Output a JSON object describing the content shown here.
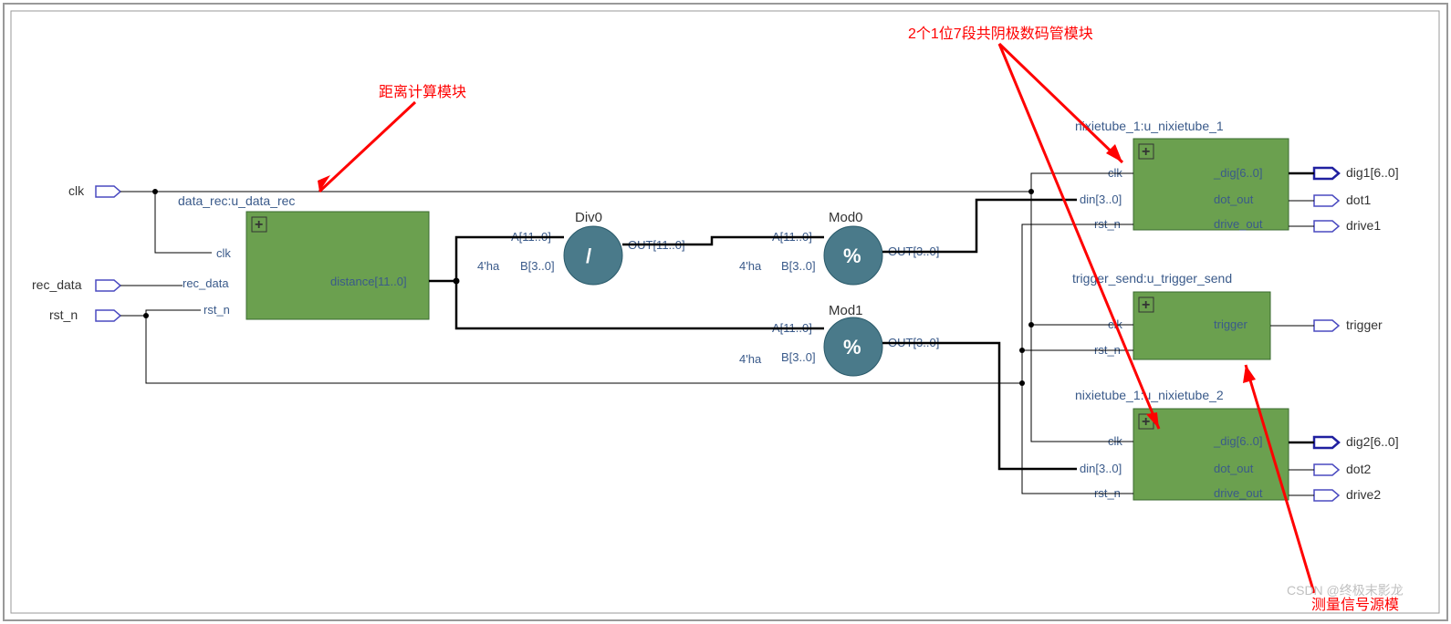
{
  "annotations": {
    "distance_module": "距离计算模块",
    "nixie_module": "2个1位7段共阴极数码管模块",
    "trigger_module": "测量信号源模",
    "watermark": "CSDN @终极末影龙"
  },
  "inputs": {
    "clk": "clk",
    "rec_data": "rec_data",
    "rst_n": "rst_n"
  },
  "outputs": {
    "dig1": "dig1[6..0]",
    "dot1": "dot1",
    "drive1": "drive1",
    "trigger": "trigger",
    "dig2": "dig2[6..0]",
    "dot2": "dot2",
    "drive2": "drive2"
  },
  "blocks": {
    "data_rec": {
      "title": "data_rec:u_data_rec",
      "ports": {
        "clk": "clk",
        "rec_data": "rec_data",
        "rst_n": "rst_n",
        "distance": "distance[11..0]"
      }
    },
    "div0": {
      "title": "Div0",
      "ports": {
        "a": "A[11..0]",
        "b": "B[3..0]",
        "out": "OUT[11..0]"
      },
      "const": "4'ha",
      "op": "/"
    },
    "mod0": {
      "title": "Mod0",
      "ports": {
        "a": "A[11..0]",
        "b": "B[3..0]",
        "out": "OUT[3..0]"
      },
      "const": "4'ha",
      "op": "%"
    },
    "mod1": {
      "title": "Mod1",
      "ports": {
        "a": "A[11..0]",
        "b": "B[3..0]",
        "out": "OUT[3..0]"
      },
      "const": "4'ha",
      "op": "%"
    },
    "nixie1": {
      "title": "nixietube_1:u_nixietube_1",
      "ports": {
        "clk": "clk",
        "din": "din[3..0]",
        "rst_n": "rst_n",
        "dig": "_dig[6..0]",
        "dot_out": "dot_out",
        "drive_out": "drive_out"
      }
    },
    "trigger_send": {
      "title": "trigger_send:u_trigger_send",
      "ports": {
        "clk": "clk",
        "rst_n": "rst_n",
        "trigger": "trigger"
      }
    },
    "nixie2": {
      "title": "nixietube_1:u_nixietube_2",
      "ports": {
        "clk": "clk",
        "din": "din[3..0]",
        "rst_n": "rst_n",
        "dig": "_dig[6..0]",
        "dot_out": "dot_out",
        "drive_out": "drive_out"
      }
    }
  }
}
